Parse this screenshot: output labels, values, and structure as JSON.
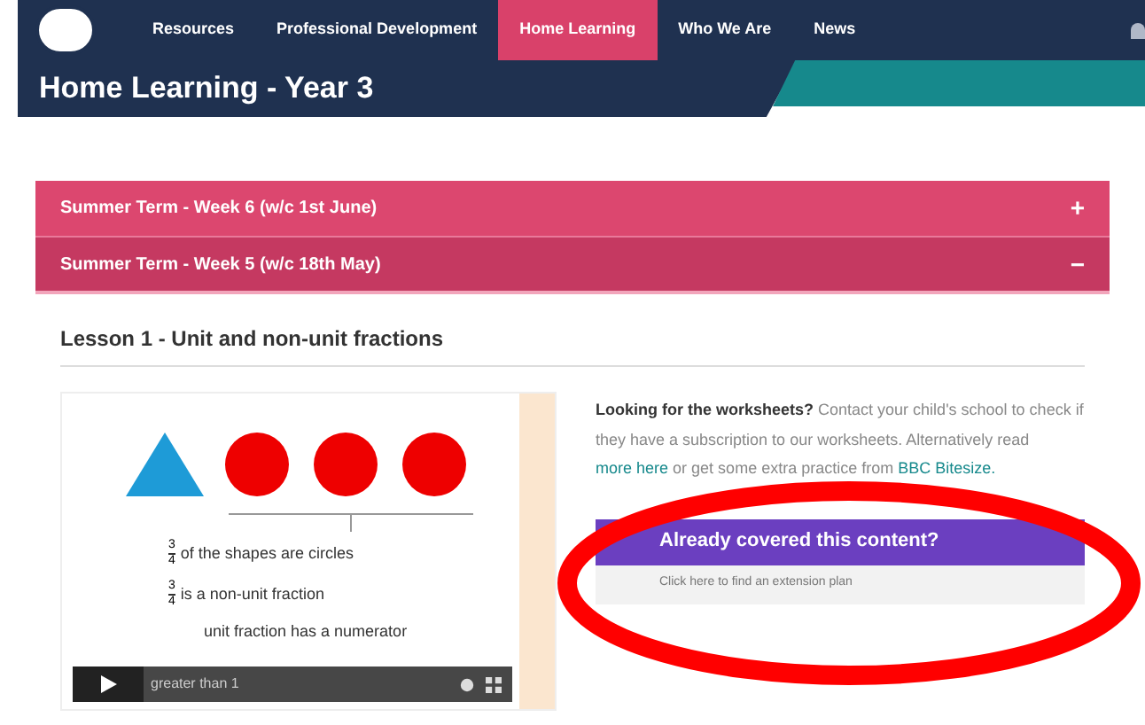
{
  "nav": {
    "items": [
      {
        "label": "Resources",
        "selected": false
      },
      {
        "label": "Professional Development",
        "selected": false
      },
      {
        "label": "Home Learning",
        "selected": true
      },
      {
        "label": "Who We Are",
        "selected": false
      },
      {
        "label": "News",
        "selected": false
      }
    ]
  },
  "page_title": "Home Learning - Year 3",
  "accordion": [
    {
      "label": "Summer Term - Week 6 (w/c 1st June)",
      "icon": "+",
      "expanded": false
    },
    {
      "label": "Summer Term - Week 5 (w/c 18th May)",
      "icon": "−",
      "expanded": true
    }
  ],
  "lesson": {
    "title": "Lesson 1 - Unit and non-unit fractions",
    "video": {
      "lines": [
        {
          "numerator": "3",
          "denominator": "4",
          "text": "of the shapes are circles"
        },
        {
          "numerator": "3",
          "denominator": "4",
          "text": "is a non-unit fraction"
        }
      ],
      "partial_line": "unit fraction has a numerator",
      "partial_line_2": "greater than 1"
    },
    "info": {
      "lead": "Looking for the worksheets?",
      "text": "Contact your child's school to check if they have a subscription to our worksheets. Alternatively read",
      "link": "more here",
      "text_2": "or get some extra practice from",
      "link_2": "BBC Bitesize."
    },
    "callout": {
      "title": "Already covered this content?",
      "subtitle": "Click here to find an extension plan"
    }
  }
}
